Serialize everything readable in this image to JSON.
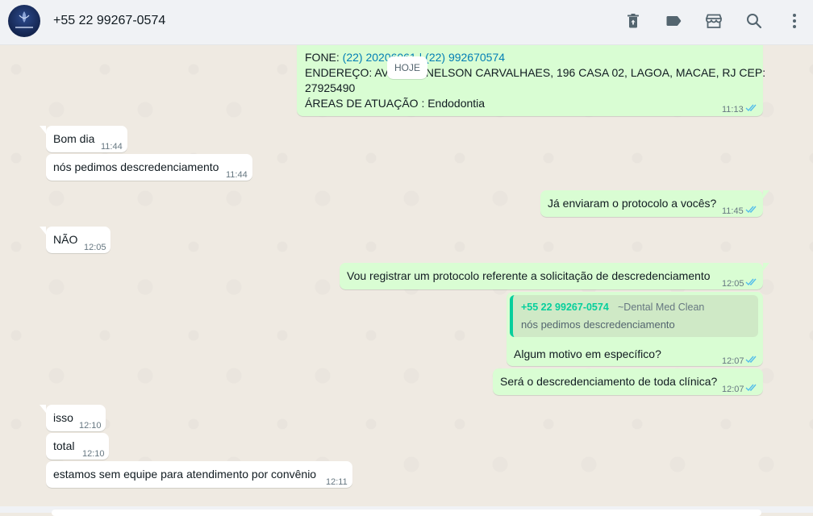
{
  "header": {
    "contact_name": "+55 22 99267-0574",
    "icons": [
      "delete-icon",
      "label-icon",
      "store-icon",
      "search-icon",
      "menu-icon"
    ]
  },
  "colors": {
    "incoming_bubble": "#ffffff",
    "outgoing_bubble": "#d9fdd3",
    "read_ticks": "#53bdeb",
    "chat_background": "#efeae2",
    "quote_accent": "#06cf9c",
    "link": "#027eb5"
  },
  "date_divider": "HOJE",
  "messages": [
    {
      "direction": "out",
      "lines": [
        {
          "prefix": "FONE: ",
          "link": "(22) 20206061 | (22) 992670574"
        },
        {
          "text": "ENDEREÇO: AVENIDA NELSON CARVALHAES, 196 CASA 02, LAGOA, MACAE, RJ CEP:"
        },
        {
          "text": "27925490"
        },
        {
          "text": "ÁREAS DE ATUAÇÃO : Endodontia"
        }
      ],
      "time": "11:13",
      "status": "read"
    },
    {
      "direction": "in",
      "text": "Bom dia",
      "time": "11:44"
    },
    {
      "direction": "in",
      "text": "nós pedimos descredenciamento",
      "time": "11:44"
    },
    {
      "direction": "out",
      "text": "Já enviaram o protocolo a vocês?",
      "time": "11:45",
      "status": "read"
    },
    {
      "direction": "in",
      "text": "NÃO",
      "time": "12:05"
    },
    {
      "direction": "out",
      "text": "Vou registrar um protocolo referente a solicitação de descredenciamento",
      "time": "12:05",
      "status": "read"
    },
    {
      "direction": "out",
      "quote": {
        "author": "+55 22 99267-0574",
        "push_name": "~Dental Med Clean",
        "text": "nós pedimos descredenciamento"
      },
      "text": "Algum motivo em específico?",
      "time": "12:07",
      "status": "read"
    },
    {
      "direction": "out",
      "text": "Será o descredenciamento de toda clínica?",
      "time": "12:07",
      "status": "read"
    },
    {
      "direction": "in",
      "text": "isso",
      "time": "12:10"
    },
    {
      "direction": "in",
      "text": "total",
      "time": "12:10"
    },
    {
      "direction": "in",
      "text": "estamos sem equipe para atendimento por convênio",
      "time": "12:11"
    }
  ]
}
